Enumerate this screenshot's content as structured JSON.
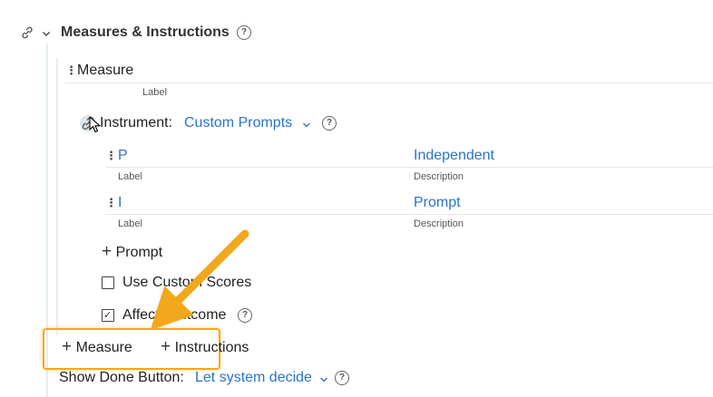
{
  "section": {
    "title": "Measures & Instructions",
    "link_icon": "link-icon",
    "collapse_icon": "chevron-down-icon",
    "help_icon": "help-icon"
  },
  "measure": {
    "name": "Measure",
    "label_caption": "Label"
  },
  "instrument": {
    "label": "Instrument:",
    "value": "Custom Prompts",
    "dropdown_icon": "chevron-down-icon",
    "help_icon": "help-icon"
  },
  "prompts": [
    {
      "label": "P",
      "label_caption": "Label",
      "description": "Independent",
      "description_caption": "Description"
    },
    {
      "label": "I",
      "label_caption": "Label",
      "description": "Prompt",
      "description_caption": "Description"
    }
  ],
  "add_prompt": {
    "plus": "+",
    "label": "Prompt"
  },
  "use_custom_scores": {
    "label": "Use Custom Scores",
    "checked": false
  },
  "affects_outcome": {
    "label": "Affects outcome",
    "checked": true,
    "check": "✓"
  },
  "add_measure": {
    "plus": "+",
    "label": "Measure"
  },
  "add_instructions": {
    "plus": "+",
    "label": "Instructions"
  },
  "show_done": {
    "label": "Show Done Button:",
    "value": "Let system decide",
    "dropdown_icon": "chevron-down-icon"
  },
  "colors": {
    "accent": "#2a73c9",
    "highlight": "#f2a81d",
    "guide": "#e3eef8"
  }
}
